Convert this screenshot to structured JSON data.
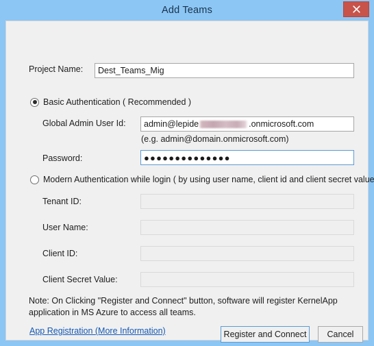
{
  "window": {
    "title": "Add Teams",
    "close_icon": "close-icon",
    "accent_border": "#8cc6f4",
    "close_button_color": "#c7534b"
  },
  "form": {
    "project_name": {
      "label": "Project Name:",
      "value": "Dest_Teams_Mig",
      "placeholder": ""
    },
    "basic_auth": {
      "option_label": "Basic Authentication ( Recommended )",
      "selected": true,
      "global_admin": {
        "label": "Global Admin User Id:",
        "value_prefix": "admin@lepide",
        "value_suffix": ".onmicrosoft.com",
        "redacted": true
      },
      "hint": "(e.g. admin@domain.onmicrosoft.com)",
      "password": {
        "label": "Password:",
        "value": "●●●●●●●●●●●●●●",
        "focused": true
      }
    },
    "modern_auth": {
      "option_label": "Modern Authentication while login ( by using user name, client id and client secret value )",
      "selected": false,
      "fields": [
        {
          "label": "Tenant ID:",
          "value": "",
          "disabled": true
        },
        {
          "label": "User Name:",
          "value": "",
          "disabled": true
        },
        {
          "label": "Client ID:",
          "value": "",
          "disabled": true
        },
        {
          "label": "Client Secret Value:",
          "value": "",
          "disabled": true
        }
      ]
    }
  },
  "note": "Note: On Clicking \"Register and Connect\" button, software will register KernelApp application in MS Azure to access all teams.",
  "footer": {
    "link": "App Registration (More Information)",
    "primary_button": "Register and Connect",
    "cancel_button": "Cancel"
  }
}
